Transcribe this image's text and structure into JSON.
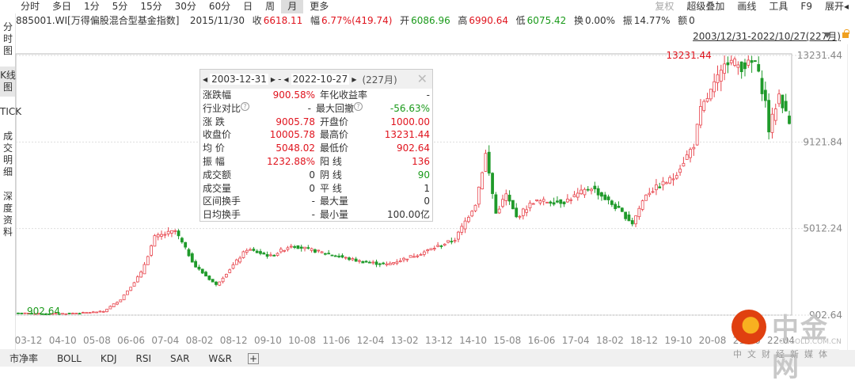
{
  "topbar": {
    "tabs": [
      "分时",
      "多日",
      "1分",
      "5分",
      "15分",
      "30分",
      "60分",
      "日",
      "周",
      "月",
      "更多"
    ],
    "selected": "月",
    "right": [
      "复权",
      "超级叠加",
      "画线",
      "工具",
      "F9",
      "展开◂"
    ]
  },
  "sidebar": [
    "分时图",
    "K线图",
    "TICK",
    "成交明细",
    "深度资料"
  ],
  "info": {
    "code": "885001.WI[万得偏股混合型基金指数]",
    "date": "2015/11/30",
    "close_label": "收",
    "close": "6618.11",
    "chg_label": "幅",
    "chg": "6.77%(419.74)",
    "open_label": "开",
    "open": "6086.96",
    "high_label": "高",
    "high": "6990.64",
    "low_label": "低",
    "low": "6075.42",
    "turnover_label": "换",
    "turnover": "0.00%",
    "amp_label": "振",
    "amp": "14.77%",
    "amount_label": "额",
    "amount": "0"
  },
  "range": "2003/12/31-2022/10/27(227月)",
  "popup": {
    "start": "2003-12-31",
    "sep": "-",
    "end": "2022-10-27",
    "months": "(227月)",
    "rows": [
      [
        "涨跌幅",
        "900.58%",
        "red",
        "年化收益率",
        "-",
        "dark"
      ],
      [
        "行业对比",
        "-",
        "dark",
        "最大回撤",
        "-56.63%",
        "green"
      ],
      [
        "涨  跌",
        "9005.78",
        "red",
        "开盘价",
        "1000.00",
        "red"
      ],
      [
        "收盘价",
        "10005.78",
        "red",
        "最高价",
        "13231.44",
        "red"
      ],
      [
        "均  价",
        "5048.02",
        "red",
        "最低价",
        "902.64",
        "red"
      ],
      [
        "振  幅",
        "1232.88%",
        "red",
        "阳  线",
        "136",
        "red"
      ],
      [
        "成交额",
        "0",
        "dark",
        "阴  线",
        "90",
        "green"
      ],
      [
        "成交量",
        "0",
        "dark",
        "平  线",
        "1",
        "dark"
      ],
      [
        "区间换手",
        "-",
        "dark",
        "最大量",
        "0",
        "dark"
      ],
      [
        "日均换手",
        "-",
        "dark",
        "最小量",
        "100.00亿",
        "dark"
      ]
    ]
  },
  "bottom_tabs": [
    "市净率",
    "BOLL",
    "KDJ",
    "RSI",
    "SAR",
    "W&R"
  ],
  "watermark": {
    "name": "中金网",
    "domain": "CNGOLD.COM.CN",
    "slogan": "中文财经新媒体"
  },
  "colors": {
    "up": "#e8454d",
    "down": "#1f9a2a"
  },
  "chart_data": {
    "type": "candlestick",
    "months": 227,
    "start": "2003-12",
    "end": "2022-10",
    "y_ticks": [
      "13231.44",
      "9121.84",
      "5012.24",
      "902.64"
    ],
    "ylim": [
      902.64,
      13231.44
    ],
    "x_ticks": [
      "03-12",
      "04-10",
      "05-08",
      "06-06",
      "07-04",
      "08-02",
      "08-12",
      "09-10",
      "10-08",
      "11-06",
      "12-04",
      "13-02",
      "13-12",
      "14-10",
      "15-08",
      "16-06",
      "17-04",
      "18-02",
      "18-12",
      "19-10",
      "20-08",
      "21-06",
      "22-04"
    ],
    "max_label": "13231.44",
    "min_label": "902.64",
    "close_keypoints": [
      [
        0,
        1000
      ],
      [
        8,
        960
      ],
      [
        18,
        1000
      ],
      [
        25,
        1080
      ],
      [
        30,
        1650
      ],
      [
        36,
        2900
      ],
      [
        40,
        4600
      ],
      [
        46,
        4900
      ],
      [
        52,
        3200
      ],
      [
        58,
        2330
      ],
      [
        67,
        4030
      ],
      [
        74,
        3700
      ],
      [
        80,
        4220
      ],
      [
        90,
        3840
      ],
      [
        100,
        3460
      ],
      [
        108,
        3300
      ],
      [
        118,
        3840
      ],
      [
        128,
        4500
      ],
      [
        134,
        6200
      ],
      [
        137,
        8550
      ],
      [
        140,
        5730
      ],
      [
        143,
        6620
      ],
      [
        146,
        5540
      ],
      [
        151,
        6300
      ],
      [
        160,
        6290
      ],
      [
        168,
        6970
      ],
      [
        176,
        5900
      ],
      [
        180,
        5270
      ],
      [
        184,
        6670
      ],
      [
        192,
        7420
      ],
      [
        198,
        9000
      ],
      [
        200,
        10630
      ],
      [
        206,
        12400
      ],
      [
        207,
        13080
      ],
      [
        212,
        12700
      ],
      [
        216,
        12900
      ],
      [
        219,
        11000
      ],
      [
        220,
        9690
      ],
      [
        223,
        11380
      ],
      [
        226,
        10006
      ]
    ]
  }
}
